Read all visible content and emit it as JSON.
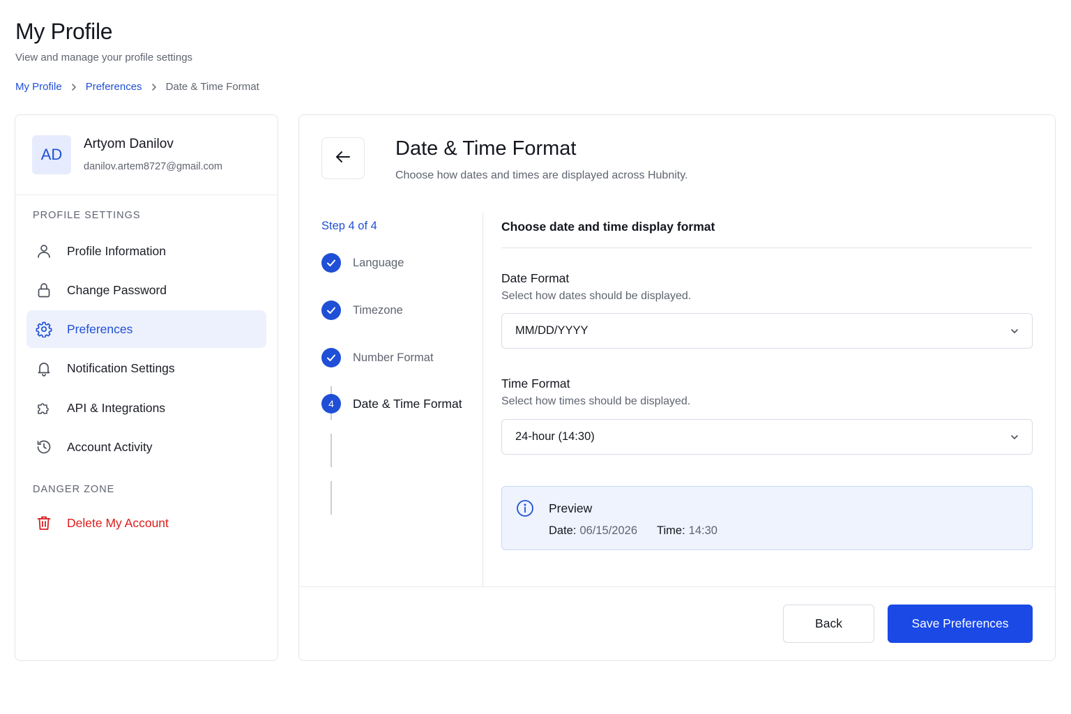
{
  "page": {
    "title": "My Profile",
    "subtitle": "View and manage your profile settings"
  },
  "breadcrumb": {
    "items": [
      "My Profile",
      "Preferences",
      "Date & Time Format"
    ]
  },
  "user": {
    "initials": "AD",
    "name": "Artyom Danilov",
    "email": "danilov.artem8727@gmail.com"
  },
  "sidebar": {
    "section_profile": "PROFILE SETTINGS",
    "section_danger": "DANGER ZONE",
    "items": [
      {
        "label": "Profile Information",
        "icon": "user-icon"
      },
      {
        "label": "Change Password",
        "icon": "lock-icon"
      },
      {
        "label": "Preferences",
        "icon": "gear-icon",
        "active": true
      },
      {
        "label": "Notification Settings",
        "icon": "bell-icon"
      },
      {
        "label": "API & Integrations",
        "icon": "puzzle-icon"
      },
      {
        "label": "Account Activity",
        "icon": "history-icon"
      }
    ],
    "danger_item": {
      "label": "Delete My Account",
      "icon": "trash-icon"
    }
  },
  "main": {
    "title": "Date & Time Format",
    "subtitle": "Choose how dates and times are displayed across Hubnity.",
    "back_icon": "arrow-left-icon"
  },
  "stepper": {
    "count": "Step 4 of 4",
    "steps": [
      {
        "label": "Language",
        "status": "complete"
      },
      {
        "label": "Timezone",
        "status": "complete"
      },
      {
        "label": "Number Format",
        "status": "complete"
      },
      {
        "label": "Date & Time Format",
        "status": "current",
        "number": "4"
      }
    ]
  },
  "form": {
    "heading": "Choose date and time display format",
    "date_format": {
      "label": "Date Format",
      "help": "Select how dates should be displayed.",
      "value": "MM/DD/YYYY"
    },
    "time_format": {
      "label": "Time Format",
      "help": "Select how times should be displayed.",
      "value": "24-hour (14:30)"
    },
    "preview": {
      "title": "Preview",
      "date_key": "Date:",
      "date_value": "06/15/2026",
      "time_key": "Time:",
      "time_value": "14:30"
    }
  },
  "actions": {
    "back": "Back",
    "save": "Save Preferences"
  },
  "colors": {
    "accent": "#1f4fd6",
    "primary_button": "#1a49e6",
    "danger": "#dc1c1c",
    "active_bg": "#edf1fd",
    "preview_bg": "#eef3fd"
  }
}
